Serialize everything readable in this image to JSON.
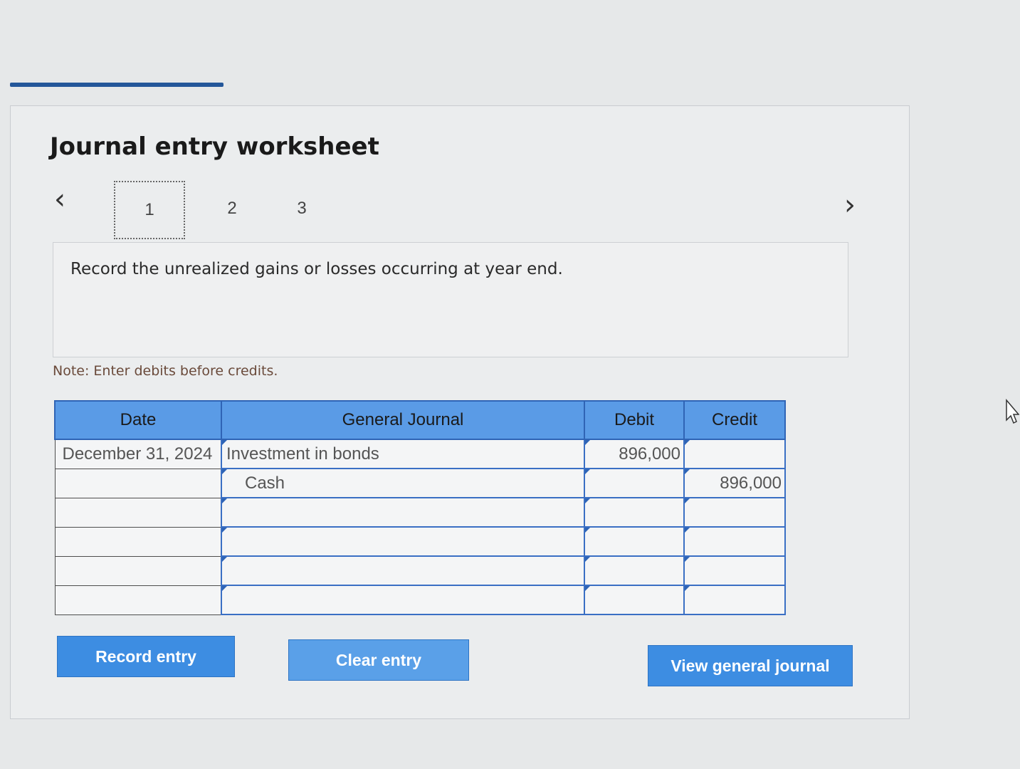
{
  "worksheet": {
    "title": "Journal entry worksheet",
    "steps": [
      "1",
      "2",
      "3"
    ],
    "active_step": 1,
    "instruction": "Record the unrealized gains or losses occurring at year end.",
    "note": "Note: Enter debits before credits."
  },
  "table": {
    "headers": {
      "date": "Date",
      "journal": "General Journal",
      "debit": "Debit",
      "credit": "Credit"
    },
    "rows": [
      {
        "date": "December 31, 2024",
        "account": "Investment in bonds",
        "debit": "896,000",
        "credit": ""
      },
      {
        "date": "",
        "account": "Cash",
        "debit": "",
        "credit": "896,000"
      },
      {
        "date": "",
        "account": "",
        "debit": "",
        "credit": ""
      },
      {
        "date": "",
        "account": "",
        "debit": "",
        "credit": ""
      },
      {
        "date": "",
        "account": "",
        "debit": "",
        "credit": ""
      },
      {
        "date": "",
        "account": "",
        "debit": "",
        "credit": ""
      }
    ]
  },
  "buttons": {
    "record": "Record entry",
    "clear": "Clear entry",
    "view": "View general journal"
  },
  "colors": {
    "header_blue": "#5a9be6",
    "button_blue": "#3d8de2",
    "accent_dark_blue": "#24579a"
  },
  "icons": {
    "prev": "chevron-left-icon",
    "next": "chevron-right-icon",
    "cursor": "mouse-pointer-icon"
  }
}
